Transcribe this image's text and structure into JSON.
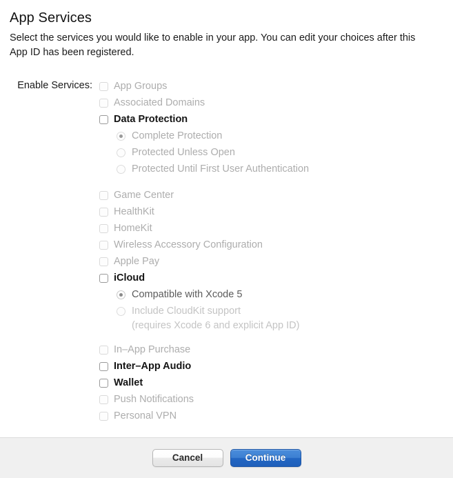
{
  "header": {
    "title": "App Services",
    "description": "Select the services you would like to enable in your app. You can edit your choices after this App ID has been registered."
  },
  "form": {
    "enable_services_label": "Enable Services:",
    "groups": [
      {
        "options": [
          {
            "type": "checkbox",
            "label": "App Groups",
            "checked": false,
            "enabled": false,
            "indent": 0
          },
          {
            "type": "checkbox",
            "label": "Associated Domains",
            "checked": false,
            "enabled": false,
            "indent": 0
          },
          {
            "type": "checkbox",
            "label": "Data Protection",
            "checked": false,
            "enabled": true,
            "indent": 0
          },
          {
            "type": "radio",
            "label": "Complete Protection",
            "checked": true,
            "enabled": false,
            "indent": 1
          },
          {
            "type": "radio",
            "label": "Protected Unless Open",
            "checked": false,
            "enabled": false,
            "indent": 1
          },
          {
            "type": "radio",
            "label": "Protected Until First User Authentication",
            "checked": false,
            "enabled": false,
            "indent": 1
          }
        ]
      },
      {
        "options": [
          {
            "type": "checkbox",
            "label": "Game Center",
            "checked": false,
            "enabled": false,
            "indent": 0
          },
          {
            "type": "checkbox",
            "label": "HealthKit",
            "checked": false,
            "enabled": false,
            "indent": 0
          },
          {
            "type": "checkbox",
            "label": "HomeKit",
            "checked": false,
            "enabled": false,
            "indent": 0
          },
          {
            "type": "checkbox",
            "label": "Wireless Accessory Configuration",
            "checked": false,
            "enabled": false,
            "indent": 0
          },
          {
            "type": "checkbox",
            "label": "Apple Pay",
            "checked": false,
            "enabled": false,
            "indent": 0
          },
          {
            "type": "checkbox",
            "label": "iCloud",
            "checked": false,
            "enabled": true,
            "indent": 0
          },
          {
            "type": "radio",
            "label": "Compatible with Xcode 5",
            "checked": true,
            "enabled": true,
            "indent": 1
          },
          {
            "type": "radio",
            "label": "Include CloudKit support",
            "note": "(requires Xcode 6 and explicit App ID)",
            "checked": false,
            "enabled": false,
            "indent": 1
          }
        ]
      },
      {
        "options": [
          {
            "type": "checkbox",
            "label": "In–App Purchase",
            "checked": false,
            "enabled": false,
            "indent": 0
          },
          {
            "type": "checkbox",
            "label": "Inter–App Audio",
            "checked": false,
            "enabled": true,
            "indent": 0
          },
          {
            "type": "checkbox",
            "label": "Wallet",
            "checked": false,
            "enabled": true,
            "indent": 0
          },
          {
            "type": "checkbox",
            "label": "Push Notifications",
            "checked": false,
            "enabled": false,
            "indent": 0
          },
          {
            "type": "checkbox",
            "label": "Personal VPN",
            "checked": false,
            "enabled": false,
            "indent": 0
          }
        ]
      }
    ]
  },
  "footer": {
    "cancel_label": "Cancel",
    "continue_label": "Continue"
  },
  "colors": {
    "accent": "#2266c3",
    "footer_background": "#f0f0f0",
    "disabled_text": "#adadad",
    "enabled_text": "#141414"
  }
}
